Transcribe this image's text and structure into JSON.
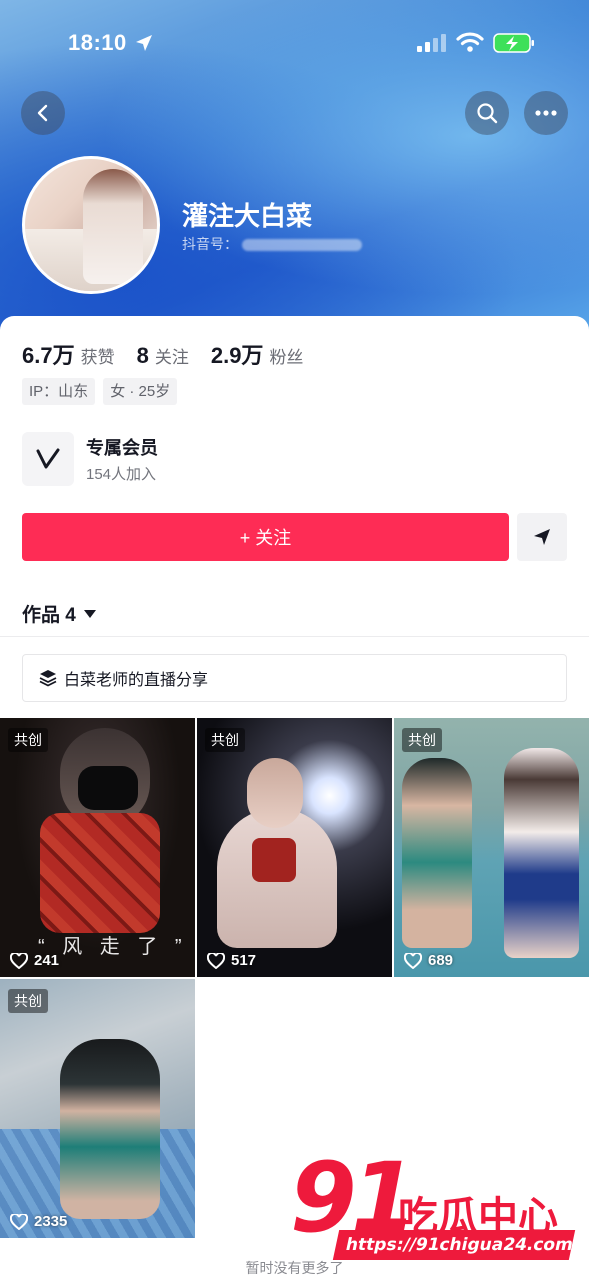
{
  "status_bar": {
    "time": "18:10"
  },
  "profile": {
    "nickname": "灌注大白菜",
    "douyin_id_label": "抖音号：",
    "stats": [
      {
        "value": "6.7万",
        "label": "获赞"
      },
      {
        "value": "8",
        "label": "关注"
      },
      {
        "value": "2.9万",
        "label": "粉丝"
      }
    ],
    "tags": [
      "IP：山东",
      "女 · 25岁"
    ]
  },
  "membership": {
    "title": "专属会员",
    "subtitle": "154人加入"
  },
  "actions": {
    "follow_label": "+ 关注"
  },
  "works": {
    "tab_label": "作品 4"
  },
  "collection": {
    "label": "白菜老师的直播分享"
  },
  "videos": [
    {
      "badge": "共创",
      "likes": "241",
      "caption": "“ 风 走 了 ”"
    },
    {
      "badge": "共创",
      "likes": "517"
    },
    {
      "badge": "共创",
      "likes": "689"
    },
    {
      "badge": "共创",
      "likes": "2335"
    }
  ],
  "footer": {
    "no_more": "暂时没有更多了"
  },
  "watermark": {
    "number": "91",
    "brand": "吃瓜中心",
    "url": "https://91chigua24.com"
  },
  "colors": {
    "follow_button": "#fe2c55",
    "banner": "#3d83d6",
    "watermark": "#ee1a3c"
  }
}
